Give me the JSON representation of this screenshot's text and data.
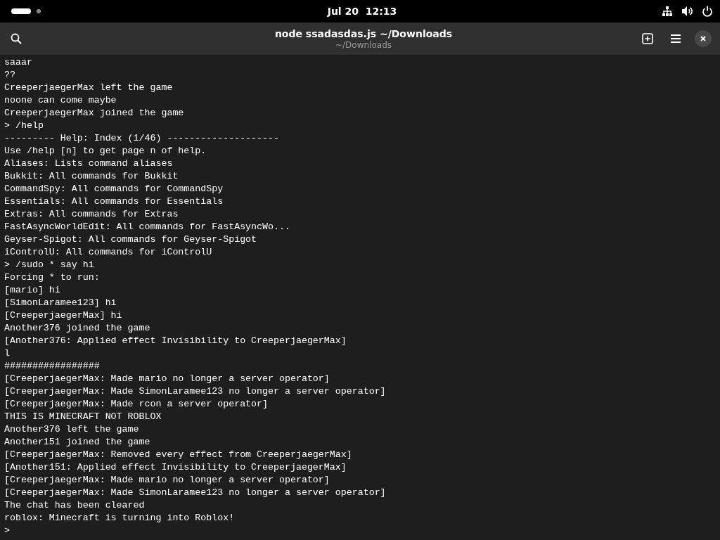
{
  "top_bar": {
    "clock": "Jul 20  12:13"
  },
  "header": {
    "title": "node ssadasdas.js ~/Downloads",
    "subtitle": "~/Downloads"
  },
  "terminal": {
    "lines": [
      "saaar",
      "??",
      "CreeperjaegerMax left the game",
      "noone can come maybe",
      "CreeperjaegerMax joined the game",
      "> /help",
      "--------- Help: Index (1/46) --------------------",
      "Use /help [n] to get page n of help.",
      "Aliases: Lists command aliases",
      "Bukkit: All commands for Bukkit",
      "CommandSpy: All commands for CommandSpy",
      "Essentials: All commands for Essentials",
      "Extras: All commands for Extras",
      "FastAsyncWorldEdit: All commands for FastAsyncWo...",
      "Geyser-Spigot: All commands for Geyser-Spigot",
      "iControlU: All commands for iControlU",
      "> /sudo * say hi",
      "Forcing * to run:",
      "[mario] hi",
      "[SimonLaramee123] hi",
      "[CreeperjaegerMax] hi",
      "Another376 joined the game",
      "[Another376: Applied effect Invisibility to CreeperjaegerMax]",
      "l",
      "#################",
      "[CreeperjaegerMax: Made mario no longer a server operator]",
      "[CreeperjaegerMax: Made SimonLaramee123 no longer a server operator]",
      "[CreeperjaegerMax: Made rcon a server operator]",
      "THIS IS MINECRAFT NOT ROBLOX",
      "Another376 left the game",
      "Another151 joined the game",
      "[CreeperjaegerMax: Removed every effect from CreeperjaegerMax]",
      "[Another151: Applied effect Invisibility to CreeperjaegerMax]",
      "[CreeperjaegerMax: Made mario no longer a server operator]",
      "[CreeperjaegerMax: Made SimonLaramee123 no longer a server operator]",
      "The chat has been cleared",
      "roblox: Minecraft is turning into Roblox!",
      ">"
    ]
  }
}
